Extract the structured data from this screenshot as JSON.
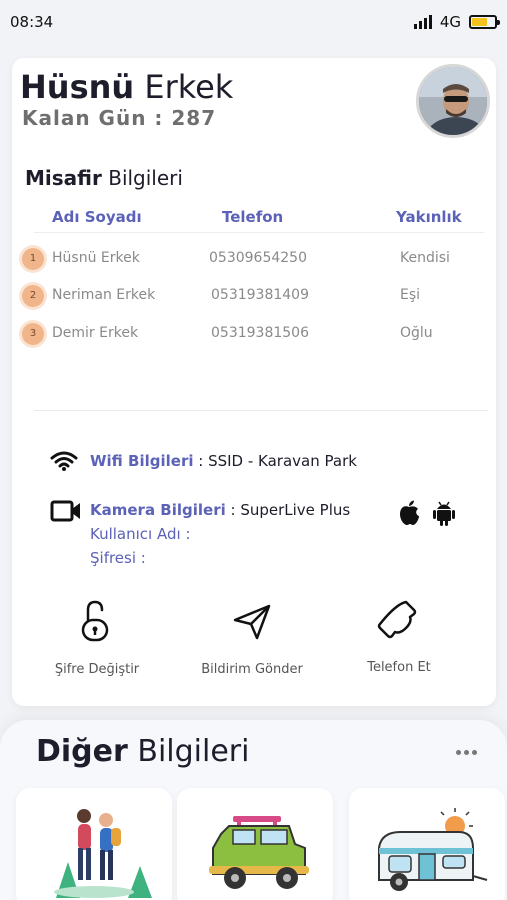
{
  "status": {
    "time": "08:34",
    "network": "4G",
    "battery_level": 0.7,
    "battery_color": "#f4c21e"
  },
  "profile": {
    "first_name": "Hüsnü",
    "last_name": "Erkek",
    "days_left": "Kalan Gün : 287"
  },
  "guests": {
    "title_bold": "Misafir",
    "title_rest": "Bilgileri",
    "headers": [
      "Adı Soyadı",
      "Telefon",
      "Yakınlık"
    ],
    "rows": [
      {
        "no": "1",
        "name": "Hüsnü Erkek",
        "phone": "05309654250",
        "relation": "Kendisi"
      },
      {
        "no": "2",
        "name": "Neriman Erkek",
        "phone": "05319381409",
        "relation": "Eşi"
      },
      {
        "no": "3",
        "name": "Demir Erkek",
        "phone": "05319381506",
        "relation": "Oğlu"
      }
    ]
  },
  "wifi": {
    "icon": "wifi-icon",
    "label": "Wifi Bilgileri",
    "value": " : SSID - Karavan Park"
  },
  "camera": {
    "icon": "video-camera-icon",
    "label": "Kamera Bilgileri",
    "value": " : SuperLive Plus",
    "username_label": "Kullanıcı Adı :",
    "password_label": "Şifresi :",
    "platforms": [
      "apple-icon",
      "android-icon"
    ]
  },
  "actions": [
    {
      "icon": "unlock-icon",
      "label": "Şifre Değiştir"
    },
    {
      "icon": "send-icon",
      "label": "Bildirim Gönder"
    },
    {
      "icon": "phone-icon",
      "label": "Telefon Et"
    }
  ],
  "other": {
    "title_bold": "Diğer",
    "title_rest": "Bilgileri",
    "tiles": [
      "hikers-illustration",
      "offroad-car-illustration",
      "caravan-illustration"
    ]
  },
  "colors": {
    "accent": "#5b62b7",
    "badge": "#f0b58a"
  }
}
